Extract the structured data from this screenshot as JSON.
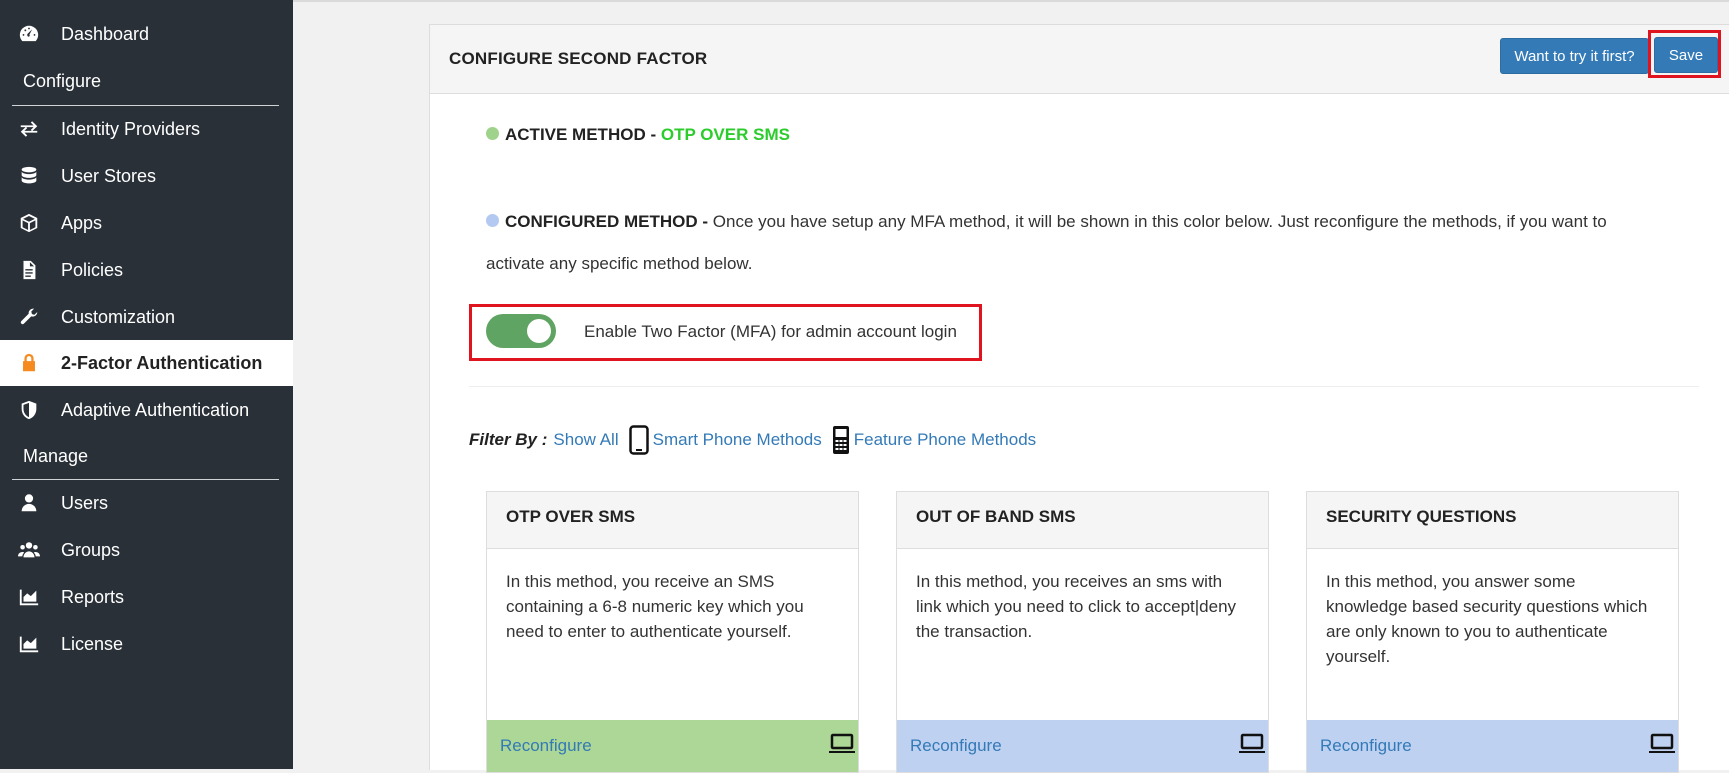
{
  "sidebar": {
    "dashboard": "Dashboard",
    "configure_label": "Configure",
    "identity_providers": "Identity Providers",
    "user_stores": "User Stores",
    "apps": "Apps",
    "policies": "Policies",
    "customization": "Customization",
    "two_factor": "2-Factor Authentication",
    "adaptive": "Adaptive Authentication",
    "manage_label": "Manage",
    "users": "Users",
    "groups": "Groups",
    "reports": "Reports",
    "license": "License"
  },
  "header": {
    "title": "CONFIGURE SECOND FACTOR",
    "try_button": "Want to try it first?",
    "save_button": "Save"
  },
  "active_method": {
    "label": "ACTIVE METHOD - ",
    "value": "OTP OVER SMS"
  },
  "configured_method": {
    "label": "CONFIGURED METHOD - ",
    "text": "Once you have setup any MFA method, it will be shown in this color below. Just reconfigure the methods, if you want to activate any specific method below."
  },
  "toggle": {
    "label": "Enable Two Factor (MFA) for admin account login",
    "enabled": true
  },
  "filter": {
    "label": "Filter By :",
    "show_all": "Show All",
    "smart_phone": "Smart Phone Methods",
    "feature_phone": "Feature Phone Methods"
  },
  "cards": [
    {
      "title": "OTP OVER SMS",
      "description": "In this method, you receive an SMS containing a 6-8 numeric key which you need to enter to authenticate yourself.",
      "action": "Reconfigure",
      "status": "active"
    },
    {
      "title": "OUT OF BAND SMS",
      "description": "In this method, you receives an sms with link which you need to click to accept|deny the transaction.",
      "action": "Reconfigure",
      "status": "configured"
    },
    {
      "title": "SECURITY QUESTIONS",
      "description": "In this method, you answer some knowledge based security questions which are only known to you to authenticate yourself.",
      "action": "Reconfigure",
      "status": "configured"
    }
  ],
  "colors": {
    "sidebar_bg": "#293038",
    "active_green": "#2ccc2c",
    "active_dot": "#9fd28a",
    "configured_dot": "#b3c9f1",
    "link_blue": "#337ab7",
    "highlight_red": "#e0141e"
  }
}
